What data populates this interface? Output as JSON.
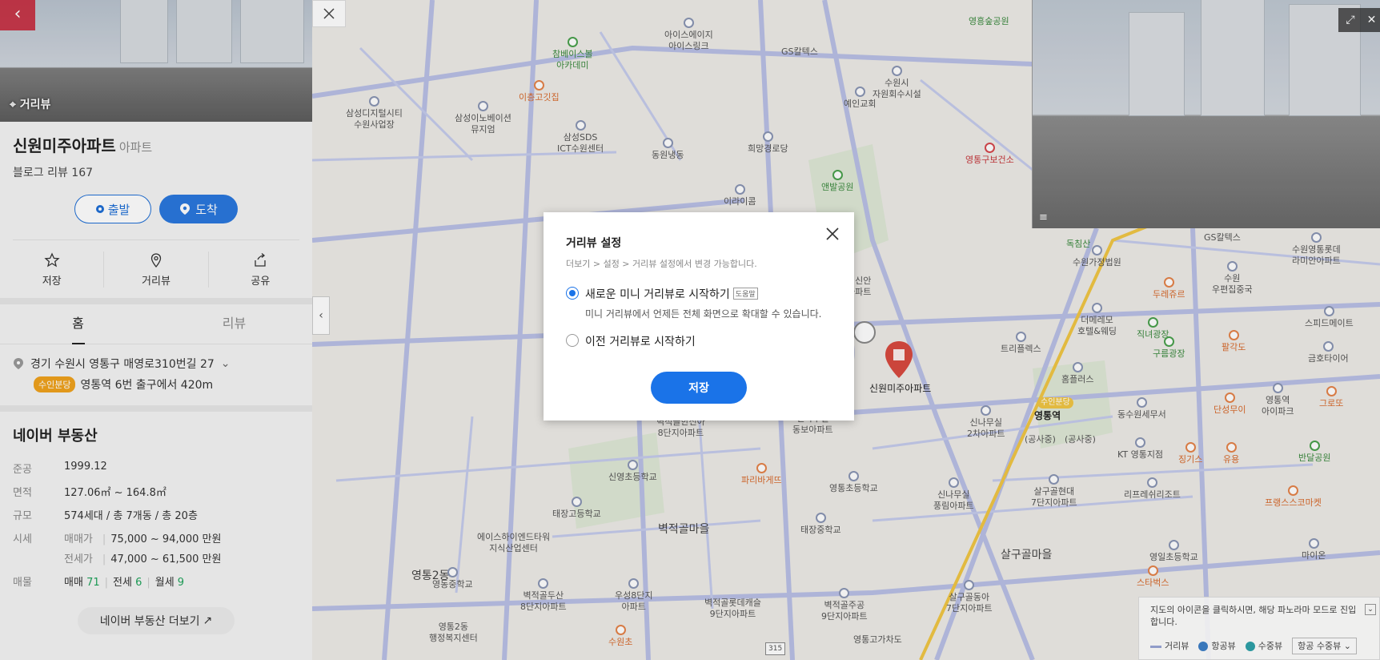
{
  "panel": {
    "street_view_label": "거리뷰",
    "place_name": "신원미주아파트",
    "place_category": "아파트",
    "blog_review": "블로그 리뷰 167",
    "start_label": "출발",
    "arrive_label": "도착",
    "actions": [
      {
        "label": "저장",
        "icon": "star-icon"
      },
      {
        "label": "거리뷰",
        "icon": "pin-icon"
      },
      {
        "label": "공유",
        "icon": "share-icon"
      }
    ],
    "tabs": [
      "홈",
      "리뷰"
    ],
    "address": "경기 수원시 영통구 매영로310번길 27",
    "station_badge": "수인분당",
    "station_text": "영통역 6번 출구에서 420m"
  },
  "real_estate": {
    "title": "네이버 부동산",
    "rows": {
      "completion": {
        "key": "준공",
        "value": "1999.12"
      },
      "area": {
        "key": "면적",
        "value": "127.06㎡ ~ 164.8㎡"
      },
      "scale": {
        "key": "규모",
        "value": "574세대 / 총 7개동 / 총 20층"
      },
      "price": {
        "key": "시세",
        "sale_label": "매매가",
        "sale_value": "75,000 ~ 94,000 만원",
        "jeonse_label": "전세가",
        "jeonse_value": "47,000 ~ 61,500 만원"
      },
      "listings": {
        "key": "매물",
        "sale_label": "매매",
        "sale_count": "71",
        "jeonse_label": "전세",
        "jeonse_count": "6",
        "monthly_label": "월세",
        "monthly_count": "9"
      }
    },
    "more_label": "네이버 부동산 더보기"
  },
  "modal": {
    "title": "거리뷰 설정",
    "subtitle": "더보기 > 설정 > 거리뷰 설정에서 변경 가능합니다.",
    "option1": "새로운 미니 거리뷰로 시작하기",
    "help_tag": "도움말",
    "option1_desc": "미니 거리뷰에서 언제든 전체 화면으로 확대할 수 있습니다.",
    "option2": "이전 거리뷰로 시작하기",
    "save_label": "저장",
    "selected_option": 1
  },
  "map": {
    "labels": [
      {
        "t": "아이스에이지\n아이스링크",
        "c": ""
      },
      {
        "t": "참베이스볼\n아카데미",
        "c": "green"
      },
      {
        "t": "이층고깃집",
        "c": "orange"
      },
      {
        "t": "삼성디지털시티\n수원사업장",
        "c": ""
      },
      {
        "t": "삼성이노베이션\n뮤지엄",
        "c": ""
      },
      {
        "t": "GS칼텍스",
        "c": ""
      },
      {
        "t": "삼성SDS\nICT수원센터",
        "c": ""
      },
      {
        "t": "동원냉동",
        "c": ""
      },
      {
        "t": "희망경로당",
        "c": ""
      },
      {
        "t": "영흥숲공원",
        "c": "green"
      },
      {
        "t": "수원시\n자원회수시설",
        "c": ""
      },
      {
        "t": "예인교회",
        "c": ""
      },
      {
        "t": "영통구보건소",
        "c": "red"
      },
      {
        "t": "앤발공원",
        "c": "green"
      },
      {
        "t": "이라이콤",
        "c": ""
      },
      {
        "t": "신원미주아파트",
        "c": ""
      },
      {
        "t": "영통역",
        "c": ""
      },
      {
        "t": "벽적골마을",
        "c": "big"
      },
      {
        "t": "살구골마을",
        "c": "big"
      },
      {
        "t": "영통2동",
        "c": "big"
      },
      {
        "t": "신나무실\n2차아파트",
        "c": ""
      },
      {
        "t": "수원가정법원",
        "c": ""
      },
      {
        "t": "두레쥬르",
        "c": "orange"
      },
      {
        "t": "수원\n우편집중국",
        "c": ""
      },
      {
        "t": "수원영통롯데\n라미안아파트",
        "c": ""
      },
      {
        "t": "스피드메이트",
        "c": ""
      },
      {
        "t": "더메레모\n호텔&웨딩",
        "c": ""
      },
      {
        "t": "직녀광장",
        "c": "green"
      },
      {
        "t": "구름광장",
        "c": "green"
      },
      {
        "t": "팔각도",
        "c": "orange"
      },
      {
        "t": "금호타이어",
        "c": ""
      },
      {
        "t": "트리플렉스",
        "c": ""
      },
      {
        "t": "홈플러스",
        "c": ""
      },
      {
        "t": "동수원세무서",
        "c": ""
      },
      {
        "t": "단성무이",
        "c": "orange"
      },
      {
        "t": "영통역\n아이파크",
        "c": ""
      },
      {
        "t": "그로또",
        "c": "orange"
      },
      {
        "t": "KT 영통지점",
        "c": ""
      },
      {
        "t": "징기스",
        "c": "orange"
      },
      {
        "t": "유용",
        "c": "orange"
      },
      {
        "t": "반달공원",
        "c": "green"
      },
      {
        "t": "리프레쉬리조트",
        "c": ""
      },
      {
        "t": "프랭스스코마켓",
        "c": "orange"
      },
      {
        "t": "벽적골한신아\n8단지아파트",
        "c": ""
      },
      {
        "t": "신나무실\n동보아파트",
        "c": ""
      },
      {
        "t": "파리바게뜨",
        "c": "orange"
      },
      {
        "t": "신영초등학교",
        "c": ""
      },
      {
        "t": "영통초등학교",
        "c": ""
      },
      {
        "t": "신나무실\n풍림아파트",
        "c": ""
      },
      {
        "t": "살구골현대\n7단지아파트",
        "c": ""
      },
      {
        "t": "태장고등학교",
        "c": ""
      },
      {
        "t": "태장중학교",
        "c": ""
      },
      {
        "t": "에이스하이엔드타워\n지식산업센터",
        "c": ""
      },
      {
        "t": "영일초등학교",
        "c": ""
      },
      {
        "t": "스타벅스",
        "c": "orange"
      },
      {
        "t": "마이온",
        "c": ""
      },
      {
        "t": "영동중학교",
        "c": ""
      },
      {
        "t": "벽적골두산\n8단지아파트",
        "c": ""
      },
      {
        "t": "우성8단지\n아파트",
        "c": ""
      },
      {
        "t": "벽적골롯데캐슬\n9단지아파트",
        "c": ""
      },
      {
        "t": "벽적골주공\n9단지아파트",
        "c": ""
      },
      {
        "t": "살구골동아\n7단지아파트",
        "c": ""
      },
      {
        "t": "영통2동\n행정복지센터",
        "c": ""
      },
      {
        "t": "수원초",
        "c": "orange"
      },
      {
        "t": "영통고가차도",
        "c": ""
      },
      {
        "t": "독침산",
        "c": "green"
      },
      {
        "t": "성신안\n아파트",
        "c": ""
      },
      {
        "t": "GS칼텍스",
        "c": ""
      },
      {
        "t": "(공사중)",
        "c": ""
      },
      {
        "t": "(공사중)",
        "c": ""
      },
      {
        "t": "수인분당",
        "c": ""
      },
      {
        "t": "315",
        "c": ""
      }
    ]
  },
  "hint": {
    "text": "지도의 아이콘을 클릭하시면, 해당 파노라마 모드로 진입합니다.",
    "legend_road": "거리뷰",
    "legend_sky": "항공뷰",
    "legend_water": "수중뷰",
    "select_label": "항공 수중뷰"
  },
  "colors": {
    "accent": "#1a73e8",
    "arrive_bg": "#2a78dd",
    "badge": "#f0a21d",
    "listing_count": "#1fa35b",
    "road": "#a9b3e3",
    "marker": "#d84a3f"
  }
}
